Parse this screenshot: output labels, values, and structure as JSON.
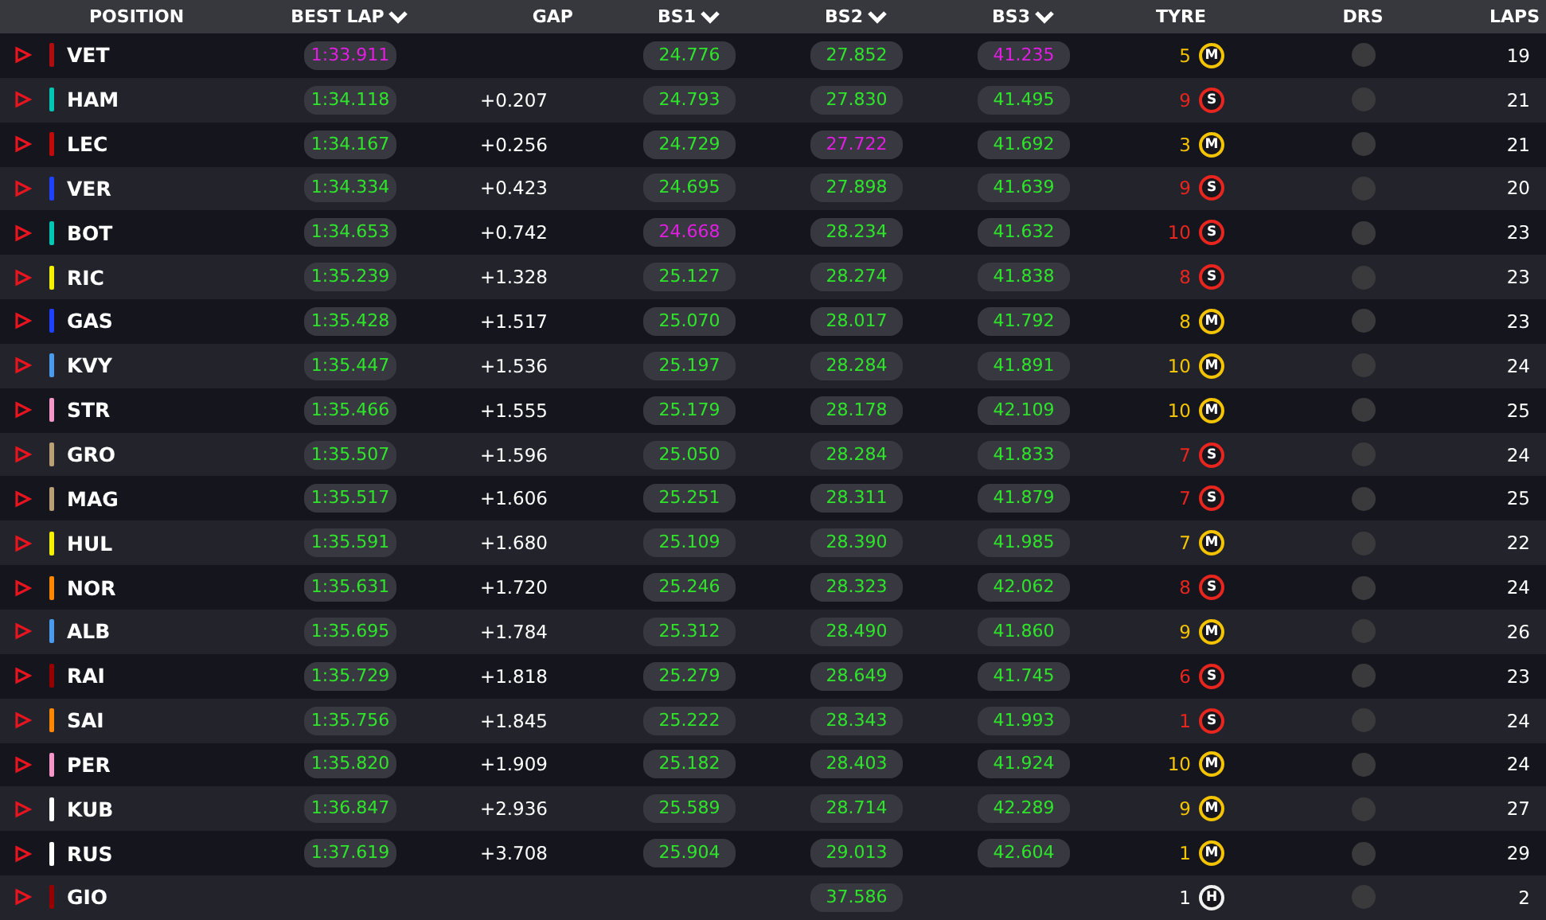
{
  "columns": [
    {
      "label": "POSITION",
      "sortable": false
    },
    {
      "label": "BEST LAP",
      "sortable": true
    },
    {
      "label": "GAP",
      "sortable": false
    },
    {
      "label": "BS1",
      "sortable": true
    },
    {
      "label": "BS2",
      "sortable": true
    },
    {
      "label": "BS3",
      "sortable": true
    },
    {
      "label": "TYRE",
      "sortable": false
    },
    {
      "label": "DRS",
      "sortable": false
    },
    {
      "label": "LAPS",
      "sortable": false
    }
  ],
  "rows": [
    {
      "code": "VET",
      "color": "#b00e0e",
      "best_lap": {
        "time": "1:33.911",
        "fastest": true
      },
      "bs1": {
        "time": "24.776",
        "fastest": false
      },
      "bs2": {
        "time": "27.852",
        "fastest": false
      },
      "bs3": {
        "time": "41.235",
        "fastest": true
      },
      "tyre": {
        "compound": "M",
        "age": "5"
      },
      "drs": false,
      "laps": "19"
    },
    {
      "code": "HAM",
      "color": "#00c8b4",
      "best_lap": {
        "time": "1:34.118",
        "fastest": false
      },
      "gap": "+0.207",
      "bs1": {
        "time": "24.793",
        "fastest": false
      },
      "bs2": {
        "time": "27.830",
        "fastest": false
      },
      "bs3": {
        "time": "41.495",
        "fastest": false
      },
      "tyre": {
        "compound": "S",
        "age": "9"
      },
      "drs": false,
      "laps": "21"
    },
    {
      "code": "LEC",
      "color": "#c00a0a",
      "best_lap": {
        "time": "1:34.167",
        "fastest": false
      },
      "gap": "+0.256",
      "bs1": {
        "time": "24.729",
        "fastest": false
      },
      "bs2": {
        "time": "27.722",
        "fastest": true
      },
      "bs3": {
        "time": "41.692",
        "fastest": false
      },
      "tyre": {
        "compound": "M",
        "age": "3"
      },
      "drs": false,
      "laps": "21"
    },
    {
      "code": "VER",
      "color": "#1e41ff",
      "best_lap": {
        "time": "1:34.334",
        "fastest": false
      },
      "gap": "+0.423",
      "bs1": {
        "time": "24.695",
        "fastest": false
      },
      "bs2": {
        "time": "27.898",
        "fastest": false
      },
      "bs3": {
        "time": "41.639",
        "fastest": false
      },
      "tyre": {
        "compound": "S",
        "age": "9"
      },
      "drs": false,
      "laps": "20"
    },
    {
      "code": "BOT",
      "color": "#00c8b4",
      "best_lap": {
        "time": "1:34.653",
        "fastest": false
      },
      "gap": "+0.742",
      "bs1": {
        "time": "24.668",
        "fastest": true
      },
      "bs2": {
        "time": "28.234",
        "fastest": false
      },
      "bs3": {
        "time": "41.632",
        "fastest": false
      },
      "tyre": {
        "compound": "S",
        "age": "10"
      },
      "drs": false,
      "laps": "23"
    },
    {
      "code": "RIC",
      "color": "#f5f000",
      "best_lap": {
        "time": "1:35.239",
        "fastest": false
      },
      "gap": "+1.328",
      "bs1": {
        "time": "25.127",
        "fastest": false
      },
      "bs2": {
        "time": "28.274",
        "fastest": false
      },
      "bs3": {
        "time": "41.838",
        "fastest": false
      },
      "tyre": {
        "compound": "S",
        "age": "8"
      },
      "drs": false,
      "laps": "23"
    },
    {
      "code": "GAS",
      "color": "#1e41ff",
      "best_lap": {
        "time": "1:35.428",
        "fastest": false
      },
      "gap": "+1.517",
      "bs1": {
        "time": "25.070",
        "fastest": false
      },
      "bs2": {
        "time": "28.017",
        "fastest": false
      },
      "bs3": {
        "time": "41.792",
        "fastest": false
      },
      "tyre": {
        "compound": "M",
        "age": "8"
      },
      "drs": false,
      "laps": "23"
    },
    {
      "code": "KVY",
      "color": "#4a9bf0",
      "best_lap": {
        "time": "1:35.447",
        "fastest": false
      },
      "gap": "+1.536",
      "bs1": {
        "time": "25.197",
        "fastest": false
      },
      "bs2": {
        "time": "28.284",
        "fastest": false
      },
      "bs3": {
        "time": "41.891",
        "fastest": false
      },
      "tyre": {
        "compound": "M",
        "age": "10"
      },
      "drs": false,
      "laps": "24"
    },
    {
      "code": "STR",
      "color": "#f596c8",
      "best_lap": {
        "time": "1:35.466",
        "fastest": false
      },
      "gap": "+1.555",
      "bs1": {
        "time": "25.179",
        "fastest": false
      },
      "bs2": {
        "time": "28.178",
        "fastest": false
      },
      "bs3": {
        "time": "42.109",
        "fastest": false
      },
      "tyre": {
        "compound": "M",
        "age": "10"
      },
      "drs": false,
      "laps": "25"
    },
    {
      "code": "GRO",
      "color": "#b9a074",
      "best_lap": {
        "time": "1:35.507",
        "fastest": false
      },
      "gap": "+1.596",
      "bs1": {
        "time": "25.050",
        "fastest": false
      },
      "bs2": {
        "time": "28.284",
        "fastest": false
      },
      "bs3": {
        "time": "41.833",
        "fastest": false
      },
      "tyre": {
        "compound": "S",
        "age": "7"
      },
      "drs": false,
      "laps": "24"
    },
    {
      "code": "MAG",
      "color": "#b9a074",
      "best_lap": {
        "time": "1:35.517",
        "fastest": false
      },
      "gap": "+1.606",
      "bs1": {
        "time": "25.251",
        "fastest": false
      },
      "bs2": {
        "time": "28.311",
        "fastest": false
      },
      "bs3": {
        "time": "41.879",
        "fastest": false
      },
      "tyre": {
        "compound": "S",
        "age": "7"
      },
      "drs": false,
      "laps": "25"
    },
    {
      "code": "HUL",
      "color": "#f5f000",
      "best_lap": {
        "time": "1:35.591",
        "fastest": false
      },
      "gap": "+1.680",
      "bs1": {
        "time": "25.109",
        "fastest": false
      },
      "bs2": {
        "time": "28.390",
        "fastest": false
      },
      "bs3": {
        "time": "41.985",
        "fastest": false
      },
      "tyre": {
        "compound": "M",
        "age": "7"
      },
      "drs": false,
      "laps": "22"
    },
    {
      "code": "NOR",
      "color": "#ff8700",
      "best_lap": {
        "time": "1:35.631",
        "fastest": false
      },
      "gap": "+1.720",
      "bs1": {
        "time": "25.246",
        "fastest": false
      },
      "bs2": {
        "time": "28.323",
        "fastest": false
      },
      "bs3": {
        "time": "42.062",
        "fastest": false
      },
      "tyre": {
        "compound": "S",
        "age": "8"
      },
      "drs": false,
      "laps": "24"
    },
    {
      "code": "ALB",
      "color": "#4a9bf0",
      "best_lap": {
        "time": "1:35.695",
        "fastest": false
      },
      "gap": "+1.784",
      "bs1": {
        "time": "25.312",
        "fastest": false
      },
      "bs2": {
        "time": "28.490",
        "fastest": false
      },
      "bs3": {
        "time": "41.860",
        "fastest": false
      },
      "tyre": {
        "compound": "M",
        "age": "9"
      },
      "drs": false,
      "laps": "26"
    },
    {
      "code": "RAI",
      "color": "#960000",
      "best_lap": {
        "time": "1:35.729",
        "fastest": false
      },
      "gap": "+1.818",
      "bs1": {
        "time": "25.279",
        "fastest": false
      },
      "bs2": {
        "time": "28.649",
        "fastest": false
      },
      "bs3": {
        "time": "41.745",
        "fastest": false
      },
      "tyre": {
        "compound": "S",
        "age": "6"
      },
      "drs": false,
      "laps": "23"
    },
    {
      "code": "SAI",
      "color": "#ff8700",
      "best_lap": {
        "time": "1:35.756",
        "fastest": false
      },
      "gap": "+1.845",
      "bs1": {
        "time": "25.222",
        "fastest": false
      },
      "bs2": {
        "time": "28.343",
        "fastest": false
      },
      "bs3": {
        "time": "41.993",
        "fastest": false
      },
      "tyre": {
        "compound": "S",
        "age": "1"
      },
      "drs": false,
      "laps": "24"
    },
    {
      "code": "PER",
      "color": "#f596c8",
      "best_lap": {
        "time": "1:35.820",
        "fastest": false
      },
      "gap": "+1.909",
      "bs1": {
        "time": "25.182",
        "fastest": false
      },
      "bs2": {
        "time": "28.403",
        "fastest": false
      },
      "bs3": {
        "time": "41.924",
        "fastest": false
      },
      "tyre": {
        "compound": "M",
        "age": "10"
      },
      "drs": false,
      "laps": "24"
    },
    {
      "code": "KUB",
      "color": "#ffffff",
      "best_lap": {
        "time": "1:36.847",
        "fastest": false
      },
      "gap": "+2.936",
      "bs1": {
        "time": "25.589",
        "fastest": false
      },
      "bs2": {
        "time": "28.714",
        "fastest": false
      },
      "bs3": {
        "time": "42.289",
        "fastest": false
      },
      "tyre": {
        "compound": "M",
        "age": "9"
      },
      "drs": false,
      "laps": "27"
    },
    {
      "code": "RUS",
      "color": "#ffffff",
      "best_lap": {
        "time": "1:37.619",
        "fastest": false
      },
      "gap": "+3.708",
      "bs1": {
        "time": "25.904",
        "fastest": false
      },
      "bs2": {
        "time": "29.013",
        "fastest": false
      },
      "bs3": {
        "time": "42.604",
        "fastest": false
      },
      "tyre": {
        "compound": "M",
        "age": "1"
      },
      "drs": false,
      "laps": "29"
    },
    {
      "code": "GIO",
      "color": "#960000",
      "bs2": {
        "time": "37.586",
        "fastest": false
      },
      "tyre": {
        "compound": "H",
        "age": "1"
      },
      "drs": false,
      "laps": "2"
    }
  ]
}
